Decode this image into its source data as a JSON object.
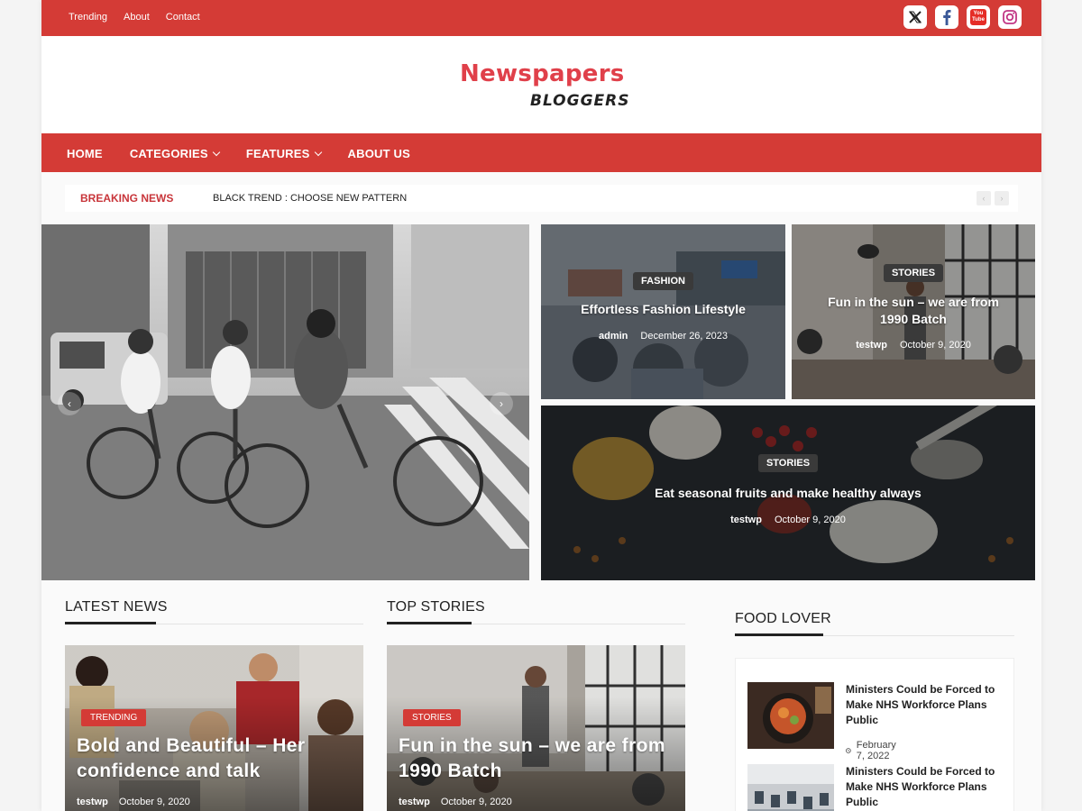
{
  "topbar": {
    "links": [
      "Trending",
      "About",
      "Contact"
    ],
    "socials": [
      "x-icon",
      "facebook-icon",
      "youtube-icon",
      "instagram-icon"
    ],
    "youtube_text_1": "You",
    "youtube_text_2": "Tube"
  },
  "header": {
    "logo_main": "Newspapers",
    "logo_sub": "BLOGGERS"
  },
  "nav": {
    "home": "HOME",
    "categories": "CATEGORIES",
    "features": "FEATURES",
    "about": "ABOUT US"
  },
  "breaking": {
    "label": "BREAKING NEWS",
    "text": "BLACK TREND : CHOOSE NEW PATTERN",
    "prev": "‹",
    "next": "›"
  },
  "featured": {
    "slider_prev": "‹",
    "slider_next": "›",
    "tile1": {
      "tag": "FASHION",
      "title": "Effortless Fashion Lifestyle",
      "author": "admin",
      "date": "December 26, 2023"
    },
    "tile2": {
      "tag": "STORIES",
      "title": "Fun in the sun – we are from 1990 Batch",
      "author": "testwp",
      "date": "October 9, 2020"
    },
    "tile3": {
      "tag": "STORIES",
      "title": "Eat seasonal fruits and make healthy always",
      "author": "testwp",
      "date": "October 9, 2020"
    }
  },
  "latest": {
    "heading": "LATEST NEWS",
    "card": {
      "tag": "TRENDING",
      "title": "Bold and Beautiful – Her confidence and talk",
      "author": "testwp",
      "date": "October 9, 2020"
    }
  },
  "top": {
    "heading": "TOP STORIES",
    "card": {
      "tag": "STORIES",
      "title": "Fun in the sun – we are from 1990 Batch",
      "author": "testwp",
      "date": "October 9, 2020"
    }
  },
  "food": {
    "heading": "FOOD LOVER",
    "items": [
      {
        "title": "Ministers Could be Forced to Make NHS Workforce Plans Public",
        "date": "February 7, 2022"
      },
      {
        "title": "Ministers Could be Forced to Make NHS Workforce Plans Public",
        "date": ""
      }
    ]
  },
  "colors": {
    "brand_red": "#d43b36",
    "logo_red": "#e0404a"
  }
}
